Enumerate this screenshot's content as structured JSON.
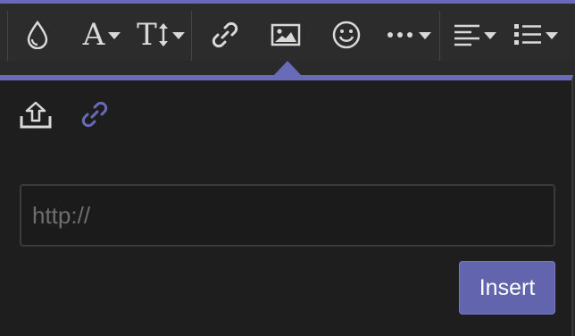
{
  "toolbar": {
    "buttons": [
      {
        "icon": "color-drop-icon"
      },
      {
        "icon": "font-family-icon",
        "glyph": "A",
        "has_dropdown": true
      },
      {
        "icon": "font-size-icon",
        "glyph": "T",
        "has_dropdown": true
      },
      {
        "icon": "link-icon"
      },
      {
        "icon": "image-icon"
      },
      {
        "icon": "emoji-icon"
      },
      {
        "icon": "more-icon",
        "has_dropdown": true
      },
      {
        "icon": "align-icon",
        "has_dropdown": true
      },
      {
        "icon": "list-icon",
        "has_dropdown": true
      }
    ]
  },
  "image_popup": {
    "tabs": [
      {
        "icon": "upload-icon",
        "active": false
      },
      {
        "icon": "link-icon",
        "active": true
      }
    ],
    "url_input": {
      "value": "",
      "placeholder": "http://"
    },
    "insert_label": "Insert"
  },
  "colors": {
    "accent": "#6a6bb8",
    "button": "#6265ad",
    "toolbar_bg": "#2c2c2c",
    "popup_bg": "#1e1e1e",
    "icon": "#d9d9d9"
  }
}
